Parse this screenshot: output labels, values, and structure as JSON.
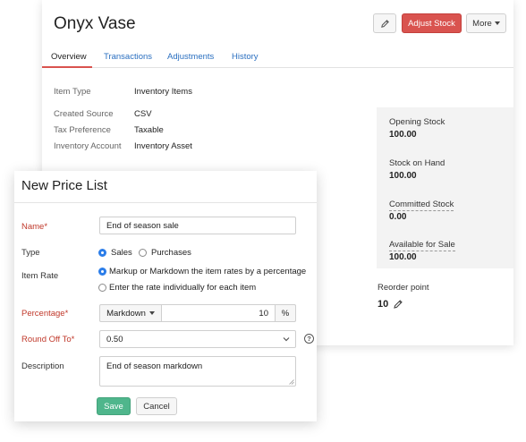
{
  "item": {
    "title": "Onyx Vase",
    "actions": {
      "adjust_stock_label": "Adjust Stock",
      "more_label": "More"
    },
    "tabs": [
      {
        "label": "Overview",
        "active": true
      },
      {
        "label": "Transactions",
        "active": false
      },
      {
        "label": "Adjustments",
        "active": false
      },
      {
        "label": "History",
        "active": false
      }
    ],
    "details": [
      {
        "label": "Item Type",
        "value": "Inventory Items"
      },
      {
        "label": "Created Source",
        "value": "CSV"
      },
      {
        "label": "Tax Preference",
        "value": "Taxable"
      },
      {
        "label": "Inventory Account",
        "value": "Inventory Asset"
      }
    ],
    "stock": [
      {
        "label": "Opening Stock",
        "value": "100.00"
      },
      {
        "label": "Stock on Hand",
        "value": "100.00"
      },
      {
        "label": "Committed Stock",
        "value": "0.00"
      },
      {
        "label": "Available for Sale",
        "value": "100.00"
      }
    ],
    "reorder": {
      "label": "Reorder point",
      "value": "10"
    }
  },
  "price_list": {
    "title": "New Price List",
    "name": {
      "label": "Name*",
      "value": "End of season sale"
    },
    "type": {
      "label": "Type",
      "options": [
        {
          "label": "Sales",
          "selected": true
        },
        {
          "label": "Purchases",
          "selected": false
        }
      ]
    },
    "item_rate": {
      "label": "Item Rate",
      "options": [
        {
          "label": "Markup or Markdown the item rates by a percentage",
          "selected": true
        },
        {
          "label": "Enter the rate individually for each item",
          "selected": false
        }
      ]
    },
    "percentage": {
      "label": "Percentage*",
      "mode": "Markdown",
      "value": "10",
      "unit": "%"
    },
    "round_off": {
      "label": "Round Off To*",
      "value": "0.50",
      "help": "?"
    },
    "description": {
      "label": "Description",
      "value": "End of season markdown"
    },
    "save_label": "Save",
    "cancel_label": "Cancel"
  },
  "colors": {
    "accent_red": "#d9534f",
    "link_blue": "#2a6fc0",
    "save_green": "#4fb68c",
    "radio_blue": "#2b7de9",
    "required_red": "#c0392b"
  }
}
